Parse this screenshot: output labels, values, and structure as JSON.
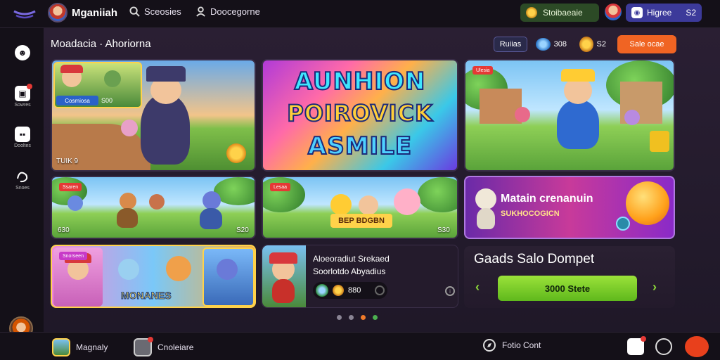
{
  "header": {
    "app_name": "Mganiiah",
    "nav": [
      {
        "label": "Sceosies",
        "icon": "search-icon"
      },
      {
        "label": "Doocegorne",
        "icon": "user-icon"
      }
    ],
    "coins_label": "Stoibaeaie",
    "user_label": "Higree",
    "user_count": "S2"
  },
  "sidebar": {
    "items": [
      {
        "label": "",
        "icon": "ghost-icon"
      },
      {
        "label": "Sowres",
        "icon": "store-icon",
        "badge": true
      },
      {
        "label": "Dooltes",
        "icon": "message-icon"
      },
      {
        "label": "Snoes",
        "icon": "hand-icon"
      }
    ]
  },
  "main": {
    "title": "Moadacia · Ahoriorna",
    "chip_label": "Ruiias",
    "gems": "308",
    "gold": "S2",
    "cta": "Sale ocae"
  },
  "cards": {
    "c1": {
      "inset_label": "Cosmiosa",
      "inset_num": "S00",
      "caption": "TUIK  9"
    },
    "hero": {
      "line1": "AUNHION",
      "line2": "POIROVICK",
      "line3": "ASMILE"
    },
    "c3": {
      "badge": "Ulesia"
    },
    "c4": {
      "badge": "Ssaren",
      "left": "630",
      "right": "S20"
    },
    "c5": {
      "badge": "Lesaa",
      "banner": "BEP BDGBN",
      "right": "S30"
    },
    "c6": {
      "title": "Matain crenanuin",
      "subtitle": "SUKHOCOGICN"
    },
    "c7": {
      "badge": "Snorseen",
      "banner": "MONANES"
    },
    "info": {
      "line1": "Aloeoradiut Srekaed",
      "line2": "Soorlotdo  Abyadius",
      "stat": "880"
    }
  },
  "promo": {
    "title": "Gaads Salo Dompet",
    "button": "3000 Stete",
    "prev": "‹",
    "next": "›"
  },
  "footer": {
    "left1": "Magnaly",
    "left2": "Cnoleiare",
    "right": "Fotio Cont"
  }
}
